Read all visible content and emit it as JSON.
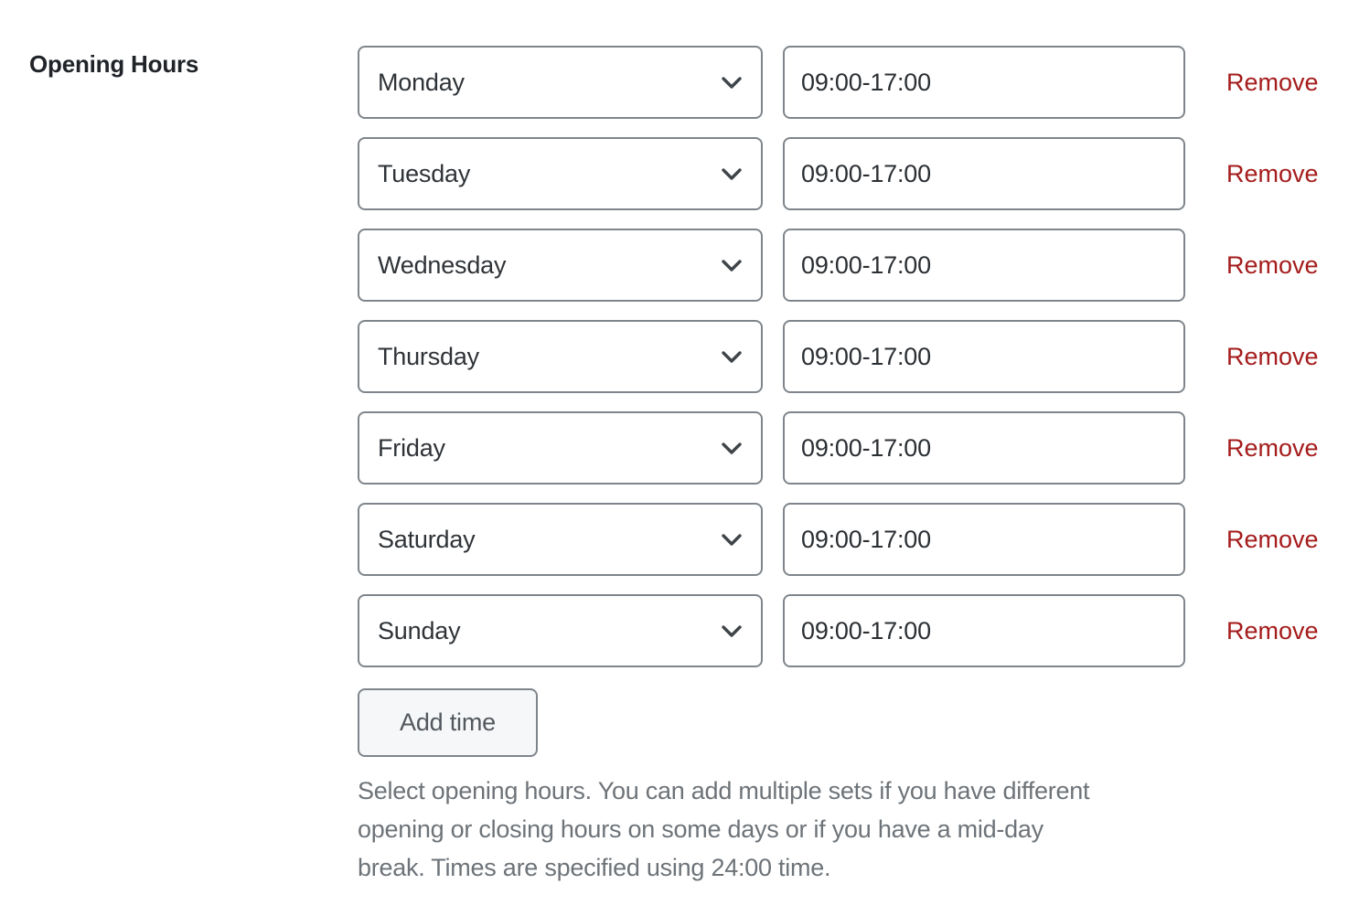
{
  "field": {
    "label": "Opening Hours",
    "help_text": "Select opening hours. You can add multiple sets if you have different opening or closing hours on some days or if you have a mid-day break. Times are specified using 24:00 time.",
    "add_button_label": "Add time",
    "remove_label": "Remove",
    "rows": [
      {
        "day": "Monday",
        "hours": "09:00-17:00",
        "remove": "Remove"
      },
      {
        "day": "Tuesday",
        "hours": "09:00-17:00",
        "remove": "Remove"
      },
      {
        "day": "Wednesday",
        "hours": "09:00-17:00",
        "remove": "Remove"
      },
      {
        "day": "Thursday",
        "hours": "09:00-17:00",
        "remove": "Remove"
      },
      {
        "day": "Friday",
        "hours": "09:00-17:00",
        "remove": "Remove"
      },
      {
        "day": "Saturday",
        "hours": "09:00-17:00",
        "remove": "Remove"
      },
      {
        "day": "Sunday",
        "hours": "09:00-17:00",
        "remove": "Remove"
      }
    ],
    "day_options": [
      "Monday",
      "Tuesday",
      "Wednesday",
      "Thursday",
      "Friday",
      "Saturday",
      "Sunday"
    ],
    "icons": {
      "select_chevron": "chevron-down-icon"
    },
    "colors": {
      "border": "#7f858b",
      "text": "#2f3337",
      "label": "#202428",
      "remove": "#a51c1c",
      "help": "#6d7378",
      "button_bg": "#f6f7f8"
    }
  }
}
